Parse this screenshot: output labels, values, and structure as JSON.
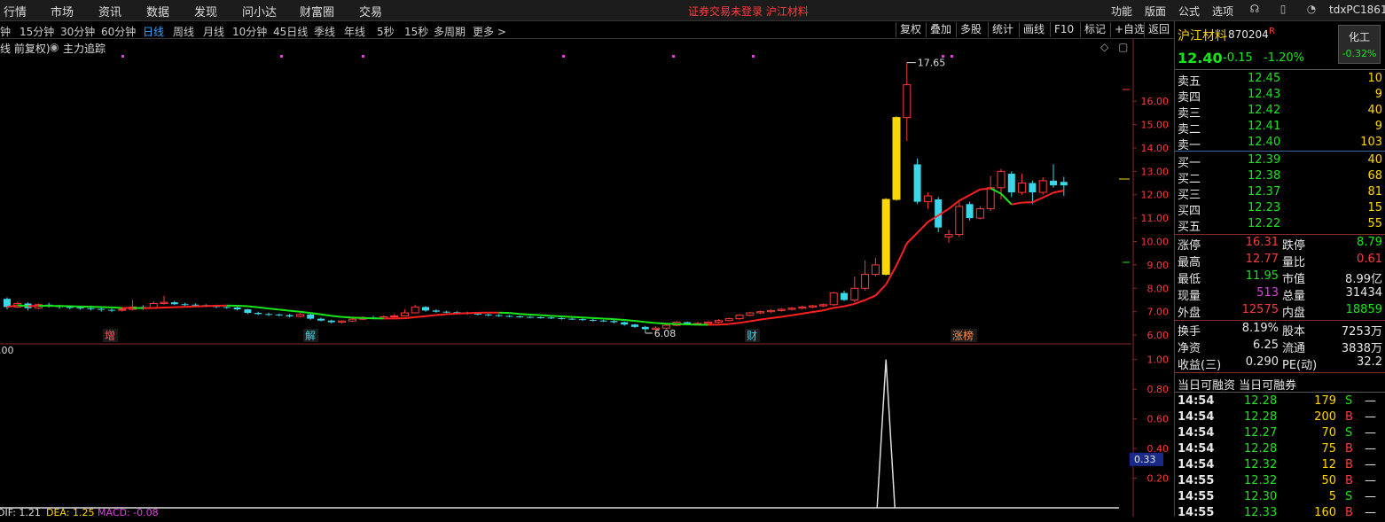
{
  "menu": {
    "items": [
      "行情",
      "市场",
      "资讯",
      "数据",
      "发现",
      "问小达",
      "财富圈",
      "交易"
    ],
    "notice": "证券交易未登录 沪江材料",
    "right_items": [
      "功能",
      "版面",
      "公式",
      "选项"
    ],
    "user": "tdxPC1861"
  },
  "period": {
    "items": [
      "钟",
      "15分钟",
      "30分钟",
      "60分钟",
      "日线",
      "周线",
      "月线",
      "10分钟",
      "45日线",
      "季线",
      "年线",
      "5秒",
      "15秒",
      "多周期",
      "更多 >"
    ],
    "active": "日线",
    "tools": [
      "复权",
      "叠加",
      "多股",
      "统计",
      "画线",
      "F10",
      "标记",
      "+自选",
      "返回"
    ]
  },
  "sub": {
    "mode": "线 前复权)",
    "indicator": "主力追踪"
  },
  "chart_data": [
    {
      "type": "candlestick",
      "title": "",
      "y_ticks": [
        "16.00",
        "15.00",
        "14.00",
        "13.00",
        "12.00",
        "11.00",
        "10.00",
        "9.00",
        "8.00",
        "7.00",
        "6.00"
      ],
      "y_range": [
        5.7,
        17.9
      ],
      "high_label": "17.65",
      "low_label": "6.08",
      "event_labels": [
        "增",
        "解",
        "财",
        "涨榜"
      ],
      "candles": [
        {
          "o": 7.55,
          "c": 7.2,
          "h": 7.62,
          "l": 7.1
        },
        {
          "o": 7.2,
          "c": 7.35,
          "h": 7.42,
          "l": 7.15
        },
        {
          "o": 7.35,
          "c": 7.15,
          "h": 7.4,
          "l": 7.05
        },
        {
          "o": 7.15,
          "c": 7.3,
          "h": 7.35,
          "l": 7.1
        },
        {
          "o": 7.3,
          "c": 7.25,
          "h": 7.38,
          "l": 7.18
        },
        {
          "o": 7.25,
          "c": 7.2,
          "h": 7.3,
          "l": 7.12
        },
        {
          "o": 7.2,
          "c": 7.18,
          "h": 7.26,
          "l": 7.1
        },
        {
          "o": 7.18,
          "c": 7.15,
          "h": 7.22,
          "l": 7.08
        },
        {
          "o": 7.15,
          "c": 7.12,
          "h": 7.2,
          "l": 7.05
        },
        {
          "o": 7.12,
          "c": 7.08,
          "h": 7.18,
          "l": 7.0
        },
        {
          "o": 7.08,
          "c": 7.06,
          "h": 7.14,
          "l": 6.98
        },
        {
          "o": 7.06,
          "c": 7.1,
          "h": 7.16,
          "l": 7.0
        },
        {
          "o": 7.1,
          "c": 7.2,
          "h": 7.5,
          "l": 7.05
        },
        {
          "o": 7.2,
          "c": 7.15,
          "h": 7.28,
          "l": 7.08
        },
        {
          "o": 7.15,
          "c": 7.35,
          "h": 7.45,
          "l": 7.12
        },
        {
          "o": 7.35,
          "c": 7.4,
          "h": 7.68,
          "l": 7.3
        },
        {
          "o": 7.4,
          "c": 7.32,
          "h": 7.46,
          "l": 7.28
        },
        {
          "o": 7.32,
          "c": 7.3,
          "h": 7.38,
          "l": 7.24
        },
        {
          "o": 7.3,
          "c": 7.28,
          "h": 7.36,
          "l": 7.22
        },
        {
          "o": 7.28,
          "c": 7.25,
          "h": 7.32,
          "l": 7.2
        },
        {
          "o": 7.25,
          "c": 7.2,
          "h": 7.3,
          "l": 7.15
        },
        {
          "o": 7.2,
          "c": 7.18,
          "h": 7.24,
          "l": 7.12
        },
        {
          "o": 7.18,
          "c": 7.1,
          "h": 7.22,
          "l": 7.05
        },
        {
          "o": 7.1,
          "c": 6.95,
          "h": 7.12,
          "l": 6.9
        },
        {
          "o": 6.95,
          "c": 6.9,
          "h": 7.0,
          "l": 6.85
        },
        {
          "o": 6.9,
          "c": 6.88,
          "h": 6.96,
          "l": 6.82
        },
        {
          "o": 6.88,
          "c": 6.85,
          "h": 6.92,
          "l": 6.8
        },
        {
          "o": 6.85,
          "c": 6.8,
          "h": 6.9,
          "l": 6.75
        },
        {
          "o": 6.8,
          "c": 6.88,
          "h": 6.94,
          "l": 6.76
        },
        {
          "o": 6.88,
          "c": 6.7,
          "h": 6.92,
          "l": 6.65
        },
        {
          "o": 6.7,
          "c": 6.62,
          "h": 6.74,
          "l": 6.58
        },
        {
          "o": 6.62,
          "c": 6.55,
          "h": 6.66,
          "l": 6.5
        },
        {
          "o": 6.55,
          "c": 6.6,
          "h": 6.64,
          "l": 6.5
        },
        {
          "o": 6.6,
          "c": 6.68,
          "h": 6.72,
          "l": 6.56
        },
        {
          "o": 6.68,
          "c": 6.75,
          "h": 6.8,
          "l": 6.64
        },
        {
          "o": 6.75,
          "c": 6.72,
          "h": 6.82,
          "l": 6.68
        },
        {
          "o": 6.72,
          "c": 6.78,
          "h": 6.84,
          "l": 6.7
        },
        {
          "o": 6.78,
          "c": 6.82,
          "h": 6.88,
          "l": 6.74
        },
        {
          "o": 6.82,
          "c": 6.95,
          "h": 7.1,
          "l": 6.8
        },
        {
          "o": 6.95,
          "c": 7.2,
          "h": 7.3,
          "l": 6.92
        },
        {
          "o": 7.2,
          "c": 7.05,
          "h": 7.24,
          "l": 7.0
        },
        {
          "o": 7.05,
          "c": 7.0,
          "h": 7.1,
          "l": 6.96
        },
        {
          "o": 7.0,
          "c": 6.98,
          "h": 7.04,
          "l": 6.94
        },
        {
          "o": 6.98,
          "c": 6.95,
          "h": 7.02,
          "l": 6.9
        },
        {
          "o": 6.95,
          "c": 6.92,
          "h": 7.0,
          "l": 6.88
        },
        {
          "o": 6.92,
          "c": 6.88,
          "h": 6.96,
          "l": 6.84
        },
        {
          "o": 6.88,
          "c": 6.85,
          "h": 6.92,
          "l": 6.8
        },
        {
          "o": 6.85,
          "c": 6.82,
          "h": 6.9,
          "l": 6.78
        },
        {
          "o": 6.82,
          "c": 6.8,
          "h": 6.86,
          "l": 6.76
        },
        {
          "o": 6.8,
          "c": 6.78,
          "h": 6.84,
          "l": 6.74
        },
        {
          "o": 6.78,
          "c": 6.76,
          "h": 6.82,
          "l": 6.72
        },
        {
          "o": 6.76,
          "c": 6.75,
          "h": 6.8,
          "l": 6.7
        },
        {
          "o": 6.75,
          "c": 6.72,
          "h": 6.78,
          "l": 6.68
        },
        {
          "o": 6.72,
          "c": 6.7,
          "h": 6.76,
          "l": 6.66
        },
        {
          "o": 6.7,
          "c": 6.68,
          "h": 6.74,
          "l": 6.64
        },
        {
          "o": 6.68,
          "c": 6.65,
          "h": 6.72,
          "l": 6.6
        },
        {
          "o": 6.65,
          "c": 6.62,
          "h": 6.7,
          "l": 6.58
        },
        {
          "o": 6.62,
          "c": 6.6,
          "h": 6.66,
          "l": 6.56
        },
        {
          "o": 6.6,
          "c": 6.55,
          "h": 6.64,
          "l": 6.5
        },
        {
          "o": 6.55,
          "c": 6.45,
          "h": 6.58,
          "l": 6.4
        },
        {
          "o": 6.45,
          "c": 6.35,
          "h": 6.48,
          "l": 6.3
        },
        {
          "o": 6.35,
          "c": 6.25,
          "h": 6.4,
          "l": 6.08
        },
        {
          "o": 6.25,
          "c": 6.3,
          "h": 6.38,
          "l": 6.2
        },
        {
          "o": 6.3,
          "c": 6.42,
          "h": 6.48,
          "l": 6.26
        },
        {
          "o": 6.42,
          "c": 6.55,
          "h": 6.6,
          "l": 6.38
        },
        {
          "o": 6.55,
          "c": 6.48,
          "h": 6.58,
          "l": 6.44
        },
        {
          "o": 6.48,
          "c": 6.5,
          "h": 6.56,
          "l": 6.44
        },
        {
          "o": 6.5,
          "c": 6.55,
          "h": 6.6,
          "l": 6.46
        },
        {
          "o": 6.55,
          "c": 6.62,
          "h": 6.68,
          "l": 6.5
        },
        {
          "o": 6.62,
          "c": 6.7,
          "h": 6.75,
          "l": 6.58
        },
        {
          "o": 6.7,
          "c": 6.85,
          "h": 6.9,
          "l": 6.65
        },
        {
          "o": 6.85,
          "c": 6.95,
          "h": 7.0,
          "l": 6.8
        },
        {
          "o": 6.95,
          "c": 7.0,
          "h": 7.05,
          "l": 6.9
        },
        {
          "o": 7.0,
          "c": 7.05,
          "h": 7.1,
          "l": 6.95
        },
        {
          "o": 7.05,
          "c": 7.1,
          "h": 7.15,
          "l": 7.0
        },
        {
          "o": 7.1,
          "c": 7.15,
          "h": 7.2,
          "l": 7.05
        },
        {
          "o": 7.15,
          "c": 7.2,
          "h": 7.25,
          "l": 7.1
        },
        {
          "o": 7.2,
          "c": 7.25,
          "h": 7.3,
          "l": 7.15
        },
        {
          "o": 7.25,
          "c": 7.3,
          "h": 7.35,
          "l": 7.2
        },
        {
          "o": 7.3,
          "c": 7.8,
          "h": 7.85,
          "l": 7.25
        },
        {
          "o": 7.8,
          "c": 7.5,
          "h": 7.9,
          "l": 7.45
        },
        {
          "o": 7.5,
          "c": 8.0,
          "h": 8.5,
          "l": 7.4
        },
        {
          "o": 8.0,
          "c": 8.6,
          "h": 9.2,
          "l": 7.9
        },
        {
          "o": 8.6,
          "c": 9.0,
          "h": 9.3,
          "l": 8.5
        },
        {
          "o": 8.6,
          "c": 11.8,
          "h": 11.85,
          "l": 8.55,
          "limit": true
        },
        {
          "o": 11.8,
          "c": 15.3,
          "h": 15.35,
          "l": 11.75,
          "limit": true
        },
        {
          "o": 15.3,
          "c": 16.7,
          "h": 17.65,
          "l": 14.3
        },
        {
          "o": 13.3,
          "c": 11.7,
          "h": 13.55,
          "l": 11.6
        },
        {
          "o": 11.7,
          "c": 11.95,
          "h": 12.1,
          "l": 11.4
        },
        {
          "o": 11.8,
          "c": 10.6,
          "h": 11.9,
          "l": 10.4
        },
        {
          "o": 10.2,
          "c": 10.3,
          "h": 10.5,
          "l": 9.95
        },
        {
          "o": 10.3,
          "c": 11.5,
          "h": 11.7,
          "l": 10.2
        },
        {
          "o": 11.6,
          "c": 11.0,
          "h": 11.7,
          "l": 10.9
        },
        {
          "o": 11.0,
          "c": 11.4,
          "h": 11.5,
          "l": 10.95
        },
        {
          "o": 11.4,
          "c": 12.3,
          "h": 12.8,
          "l": 11.3
        },
        {
          "o": 12.3,
          "c": 13.0,
          "h": 13.1,
          "l": 11.8
        },
        {
          "o": 12.9,
          "c": 12.1,
          "h": 13.0,
          "l": 11.9
        },
        {
          "o": 12.1,
          "c": 12.5,
          "h": 12.9,
          "l": 12.0
        },
        {
          "o": 12.5,
          "c": 12.1,
          "h": 12.6,
          "l": 11.6
        },
        {
          "o": 12.1,
          "c": 12.6,
          "h": 12.75,
          "l": 12.0
        },
        {
          "o": 12.6,
          "c": 12.4,
          "h": 13.3,
          "l": 12.3
        },
        {
          "o": 12.55,
          "c": 12.4,
          "h": 12.77,
          "l": 11.95
        }
      ]
    },
    {
      "type": "line",
      "title": "MACD",
      "y_ticks": [
        "1.00",
        "0.80",
        "0.60",
        "0.40",
        "0.20"
      ],
      "y_range": [
        0.0,
        1.1
      ],
      "current_value": "0.33",
      "values": [
        0,
        0,
        0,
        0,
        0,
        0,
        0,
        0,
        0,
        0,
        0,
        0,
        0,
        0,
        0,
        0,
        0,
        0,
        0,
        0,
        0,
        0,
        0,
        0,
        0,
        0,
        0,
        0,
        0,
        0,
        0,
        0,
        0,
        0,
        0,
        0,
        0,
        0,
        0,
        0,
        0,
        0,
        0,
        0,
        0,
        0,
        0,
        0,
        0,
        0,
        0,
        0,
        0,
        0,
        0,
        0,
        0,
        0,
        0,
        0,
        0,
        0,
        0,
        0,
        0,
        0,
        0,
        0,
        0,
        0,
        0,
        0,
        0,
        0,
        0,
        0,
        0,
        0,
        0,
        0,
        0,
        0,
        0,
        0,
        1.0,
        0,
        0,
        0,
        0,
        0,
        0,
        0,
        0,
        0,
        0,
        0,
        0,
        0,
        0,
        0,
        0,
        0,
        0,
        0,
        0
      ],
      "legend": {
        "first": "DIF: 1.21",
        "dea": "DEA: 1.25",
        "macd": "MACD: -0.08"
      },
      "left_value": ".00"
    }
  ],
  "quote": {
    "name": "沪江材料",
    "code": "870204",
    "code_badge": "R",
    "sector": "化工",
    "sector_change": "-0.32%",
    "price": "12.40",
    "change": "-0.15",
    "change_pct": "-1.20%",
    "asks": [
      {
        "label": "卖五",
        "price": "12.45",
        "vol": "10"
      },
      {
        "label": "卖四",
        "price": "12.43",
        "vol": "9"
      },
      {
        "label": "卖三",
        "price": "12.42",
        "vol": "40"
      },
      {
        "label": "卖二",
        "price": "12.41",
        "vol": "9"
      },
      {
        "label": "卖一",
        "price": "12.40",
        "vol": "103"
      }
    ],
    "bids": [
      {
        "label": "买一",
        "price": "12.39",
        "vol": "40"
      },
      {
        "label": "买二",
        "price": "12.38",
        "vol": "68"
      },
      {
        "label": "买三",
        "price": "12.37",
        "vol": "81"
      },
      {
        "label": "买四",
        "price": "12.23",
        "vol": "15"
      },
      {
        "label": "买五",
        "price": "12.22",
        "vol": "55"
      }
    ],
    "stats": [
      {
        "l1": "涨停",
        "v1": "16.31",
        "l2": "跌停",
        "v2": "8.79"
      },
      {
        "l1": "最高",
        "v1": "12.77",
        "l2": "量比",
        "v2": "0.61"
      },
      {
        "l1": "最低",
        "v1": "11.95",
        "l2": "市值",
        "v2": "8.99亿"
      },
      {
        "l1": "现量",
        "v1": "513",
        "l2": "总量",
        "v2": "31434"
      },
      {
        "l1": "外盘",
        "v1": "12575",
        "l2": "内盘",
        "v2": "18859"
      }
    ],
    "stats2": [
      {
        "l1": "换手",
        "v1": "8.19%",
        "l2": "股本",
        "v2": "7253万"
      },
      {
        "l1": "净资",
        "v1": "6.25",
        "l2": "流通",
        "v2": "3838万"
      },
      {
        "l1": "收益(三)",
        "v1": "0.290",
        "l2": "PE(动)",
        "v2": "32.2"
      }
    ],
    "margin_text": "当日可融资 当日可融券",
    "ticks": [
      {
        "time": "14:54",
        "price": "12.28",
        "vol": "179",
        "side": "S",
        "mark": "—"
      },
      {
        "time": "14:54",
        "price": "12.28",
        "vol": "200",
        "side": "B",
        "mark": "—"
      },
      {
        "time": "14:54",
        "price": "12.27",
        "vol": "70",
        "side": "S",
        "mark": "—"
      },
      {
        "time": "14:54",
        "price": "12.28",
        "vol": "75",
        "side": "B",
        "mark": "—"
      },
      {
        "time": "14:54",
        "price": "12.32",
        "vol": "12",
        "side": "B",
        "mark": "—"
      },
      {
        "time": "14:55",
        "price": "12.32",
        "vol": "50",
        "side": "B",
        "mark": "—"
      },
      {
        "time": "14:55",
        "price": "12.30",
        "vol": "5",
        "side": "S",
        "mark": "—"
      },
      {
        "time": "14:55",
        "price": "12.33",
        "vol": "160",
        "side": "B",
        "mark": "—"
      }
    ]
  },
  "colors": {
    "up": "#ff3a3a",
    "down": "#3ad7e8",
    "limit": "#ffd700",
    "ma_up": "#ff2020",
    "ma_down": "#19e619",
    "accent": "#39a0ff"
  }
}
